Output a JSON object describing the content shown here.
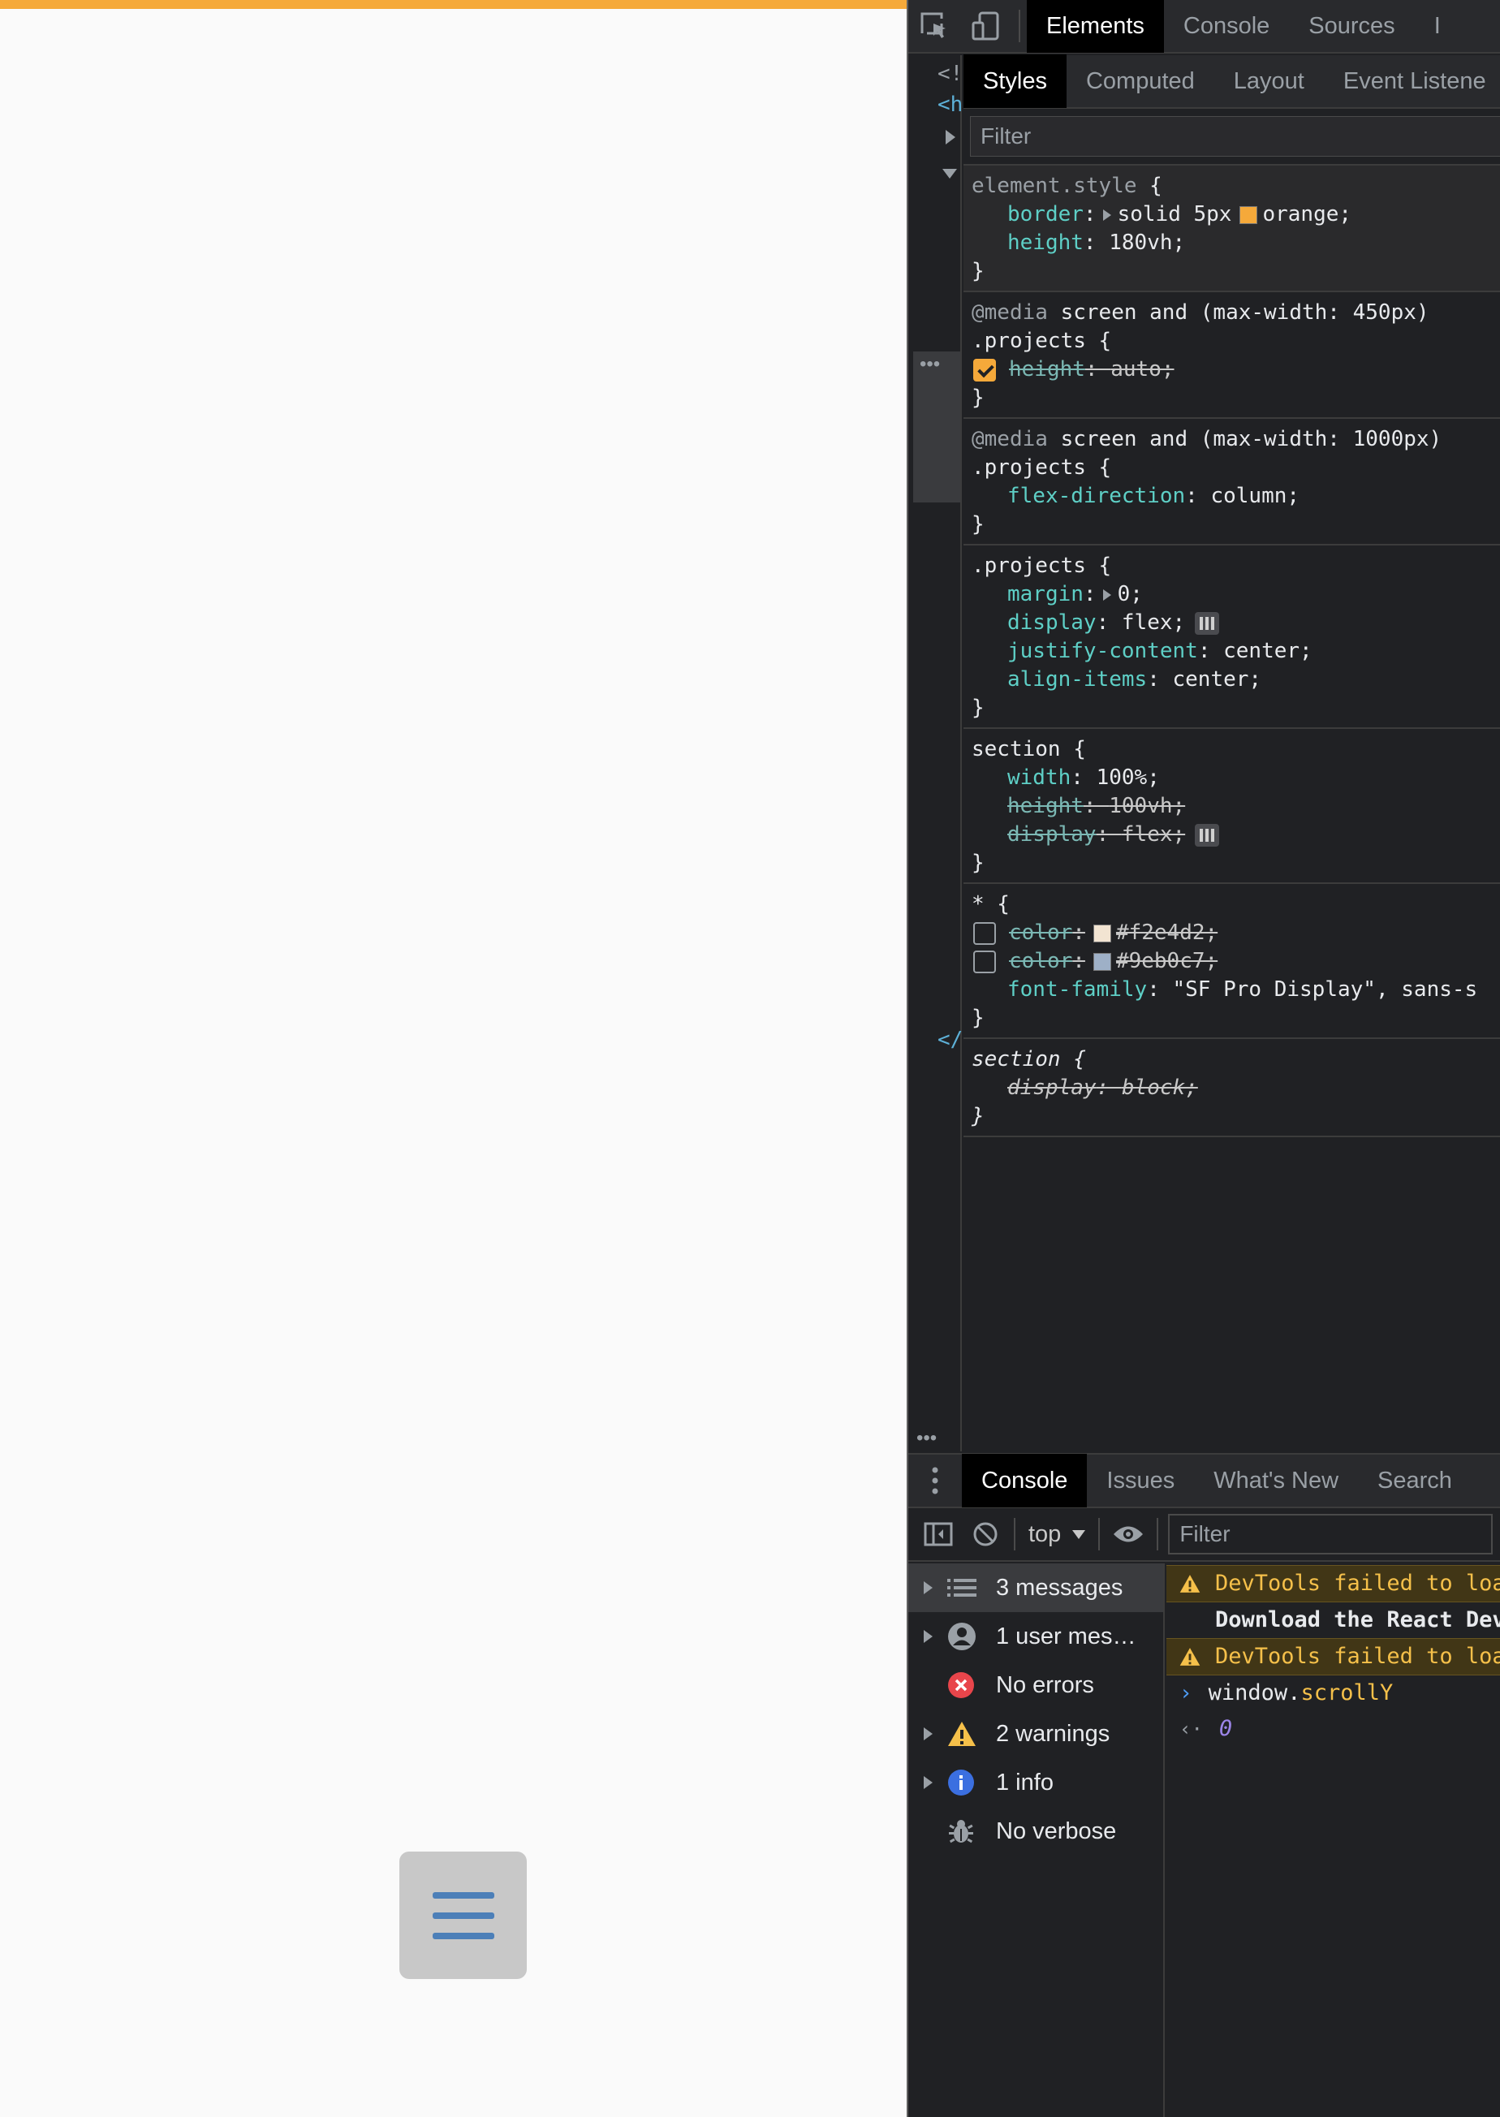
{
  "page": {
    "accent_border_color": "#f5a93a",
    "menu_button_icon": "hamburger-icon"
  },
  "devtools": {
    "main_tabs": [
      "Elements",
      "Console",
      "Sources",
      "I"
    ],
    "dom_gutter": {
      "doctype": "<!",
      "html_open": "<h",
      "close_tag": "</"
    },
    "styles_tabs": [
      "Styles",
      "Computed",
      "Layout",
      "Event Listene"
    ],
    "styles_filter_placeholder": "Filter",
    "rules": {
      "element_style": {
        "selector": "element.style",
        "border_prop": "border",
        "border_val_a": "solid 5px",
        "border_swatch": "#f5a93a",
        "border_val_b": "orange;",
        "height_prop": "height",
        "height_val": "180vh;"
      },
      "media450": {
        "at": "@media",
        "query": "screen and (max-width: 450px)",
        "selector": ".projects {",
        "height_prop": "height",
        "height_val": "auto;"
      },
      "media1000": {
        "at": "@media",
        "query": "screen and (max-width: 1000px)",
        "selector": ".projects {",
        "prop": "flex-direction",
        "val": "column;"
      },
      "projects": {
        "selector": ".projects {",
        "margin_prop": "margin",
        "margin_val": "0;",
        "display_prop": "display",
        "display_val": "flex;",
        "justify_prop": "justify-content",
        "justify_val": "center;",
        "align_prop": "align-items",
        "align_val": "center;"
      },
      "section": {
        "selector": "section {",
        "width_prop": "width",
        "width_val": "100%;",
        "height_prop": "height",
        "height_val": "100vh;",
        "display_prop": "display",
        "display_val": "flex;"
      },
      "universal": {
        "selector": "* {",
        "color1_prop": "color",
        "color1_val": "#f2e4d2;",
        "color1_swatch": "#f2e4d2",
        "color2_prop": "color",
        "color2_val": "#9eb0c7;",
        "color2_swatch": "#9eb0c7",
        "font_prop": "font-family",
        "font_val": "\"SF Pro Display\", sans-s"
      },
      "ua_section": {
        "selector": "section {",
        "display_prop": "display",
        "display_val": "block;"
      },
      "close_brace": "}"
    },
    "drawer": {
      "tabs": [
        "Console",
        "Issues",
        "What's New",
        "Search"
      ],
      "context": "top",
      "filter_placeholder": "Filter",
      "sidebar": [
        {
          "label": "3 messages",
          "icon": "list-icon"
        },
        {
          "label": "1 user mes…",
          "icon": "user-icon"
        },
        {
          "label": "No errors",
          "icon": "error-icon"
        },
        {
          "label": "2 warnings",
          "icon": "warning-icon"
        },
        {
          "label": "1 info",
          "icon": "info-icon"
        },
        {
          "label": "No verbose",
          "icon": "bug-icon"
        }
      ],
      "log": {
        "warn1": "DevTools failed to loa",
        "download": "Download the React Dev",
        "warn2": "DevTools failed to loa",
        "input_obj": "window.",
        "input_prop": "scrollY",
        "result": "0"
      }
    }
  }
}
